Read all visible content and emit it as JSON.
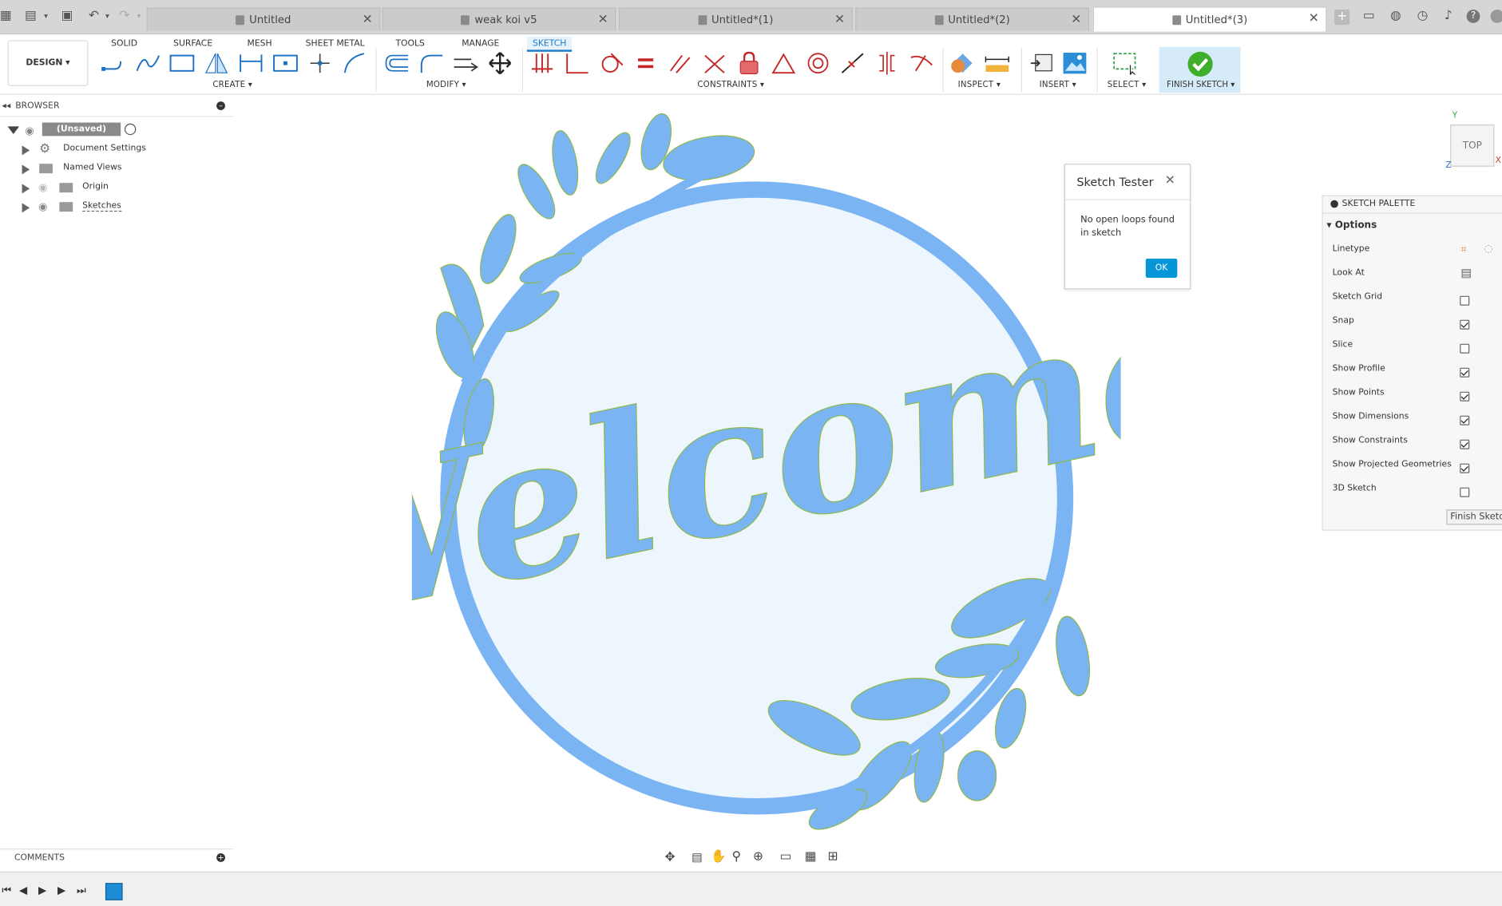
{
  "tabs": [
    {
      "label": "Untitled",
      "active": false
    },
    {
      "label": "weak koi v5",
      "active": false
    },
    {
      "label": "Untitled*(1)",
      "active": false
    },
    {
      "label": "Untitled*(2)",
      "active": false
    },
    {
      "label": "Untitled*(3)",
      "active": true
    }
  ],
  "workspace": {
    "label": "DESIGN"
  },
  "ws_tabs": [
    "SOLID",
    "SURFACE",
    "MESH",
    "SHEET METAL",
    "TOOLS",
    "MANAGE",
    "SKETCH"
  ],
  "groups": {
    "create": "CREATE",
    "modify": "MODIFY",
    "constraints": "CONSTRAINTS",
    "inspect": "INSPECT",
    "insert": "INSERT",
    "select": "SELECT",
    "finish": "FINISH SKETCH"
  },
  "browser": {
    "title": "BROWSER",
    "items": [
      {
        "label": "(Unsaved)"
      },
      {
        "label": "Document Settings"
      },
      {
        "label": "Named Views"
      },
      {
        "label": "Origin"
      },
      {
        "label": "Sketches"
      }
    ]
  },
  "comments": {
    "title": "COMMENTS"
  },
  "dialog": {
    "title": "Sketch Tester",
    "message": "No open loops found in sketch",
    "ok": "OK"
  },
  "palette": {
    "title": "SKETCH PALETTE",
    "section": "Options",
    "rows": [
      {
        "label": "Linetype",
        "type": "icon"
      },
      {
        "label": "Look At",
        "type": "icon"
      },
      {
        "label": "Sketch Grid",
        "checked": false
      },
      {
        "label": "Snap",
        "checked": true
      },
      {
        "label": "Slice",
        "checked": false
      },
      {
        "label": "Show Profile",
        "checked": true
      },
      {
        "label": "Show Points",
        "checked": true
      },
      {
        "label": "Show Dimensions",
        "checked": true
      },
      {
        "label": "Show Constraints",
        "checked": true
      },
      {
        "label": "Show Projected Geometries",
        "checked": true
      },
      {
        "label": "3D Sketch",
        "checked": false
      }
    ],
    "finish_button": "Finish Sketch"
  },
  "viewcube": {
    "face": "TOP",
    "axes": {
      "y": "Y",
      "z": "Z",
      "x": "X"
    }
  },
  "canvas": {
    "text": "Welcome",
    "fill": "#7ab4f2",
    "inner": "#eef6fd",
    "outline": "#8fb84a"
  }
}
